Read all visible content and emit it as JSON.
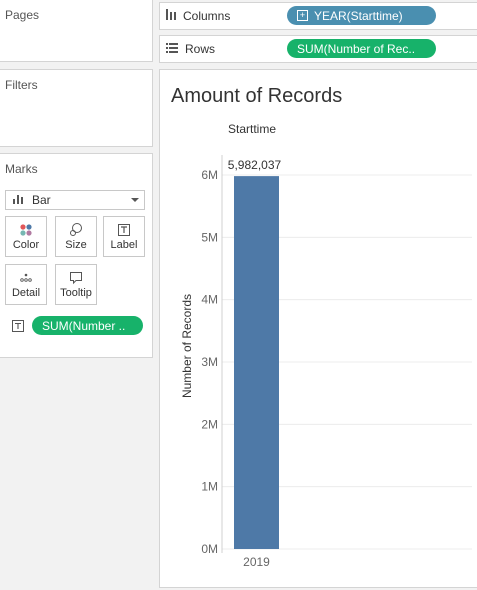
{
  "pages": {
    "title": "Pages"
  },
  "filters": {
    "title": "Filters"
  },
  "marks": {
    "title": "Marks",
    "mark_type": "Bar",
    "buttons": [
      {
        "label": "Color",
        "icon": "color-icon"
      },
      {
        "label": "Size",
        "icon": "size-icon"
      },
      {
        "label": "Label",
        "icon": "label-icon"
      },
      {
        "label": "Detail",
        "icon": "detail-icon"
      },
      {
        "label": "Tooltip",
        "icon": "tooltip-icon"
      }
    ],
    "label_field": "SUM(Number .."
  },
  "columns": {
    "label": "Columns",
    "pill": "YEAR(Starttime)"
  },
  "rows": {
    "label": "Rows",
    "pill": "SUM(Number of Rec.."
  },
  "view": {
    "title": "Amount of Records",
    "header": "Starttime"
  },
  "colors": {
    "bar": "#4e79a7",
    "pill_green": "#17b26a",
    "pill_blue": "#4a8fb0"
  },
  "chart_data": {
    "type": "bar",
    "title": "Amount of Records",
    "column_header": "Starttime",
    "categories": [
      "2019"
    ],
    "values": [
      5982037
    ],
    "data_labels": [
      "5,982,037"
    ],
    "ylabel": "Number of Records",
    "xlabel": "",
    "yticks": [
      "0M",
      "1M",
      "2M",
      "3M",
      "4M",
      "5M",
      "6M"
    ],
    "ylim": [
      0,
      6000000
    ],
    "grid": true
  }
}
